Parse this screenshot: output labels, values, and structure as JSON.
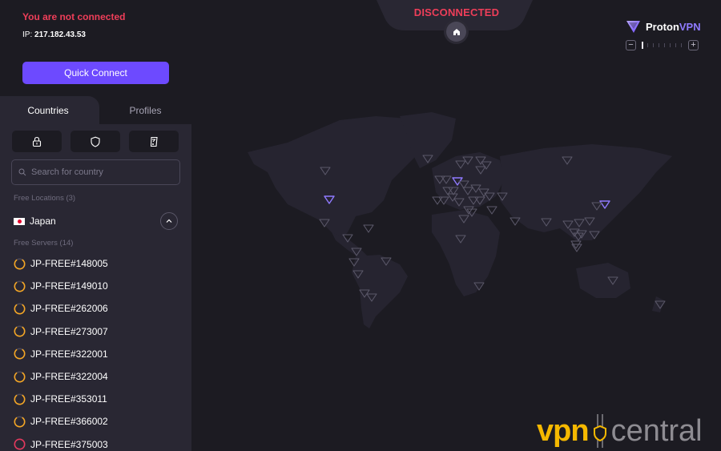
{
  "connection": {
    "status_text": "You are not connected",
    "ip_label": "IP:",
    "ip_value": "217.182.43.53",
    "quick_connect_label": "Quick Connect",
    "map_status": "DISCONNECTED"
  },
  "tabs": [
    {
      "label": "Countries",
      "active": true
    },
    {
      "label": "Profiles",
      "active": false
    }
  ],
  "filters": [
    {
      "icon": "lock-icon",
      "label": "Secure Core"
    },
    {
      "icon": "shield-icon",
      "label": "NetShield"
    },
    {
      "icon": "document-phone-icon",
      "label": "Streaming"
    }
  ],
  "search": {
    "placeholder": "Search for country",
    "value": ""
  },
  "free_locations": {
    "label": "Free Locations (3)",
    "country": {
      "name": "Japan",
      "flag": "jp-flag",
      "expanded": true
    }
  },
  "free_servers": {
    "label": "Free Servers (14)",
    "items": [
      {
        "name": "JP-FREE#148005",
        "load_color": "#f5a623"
      },
      {
        "name": "JP-FREE#149010",
        "load_color": "#f5a623"
      },
      {
        "name": "JP-FREE#262006",
        "load_color": "#f5a623"
      },
      {
        "name": "JP-FREE#273007",
        "load_color": "#f5a623"
      },
      {
        "name": "JP-FREE#322001",
        "load_color": "#f5a623"
      },
      {
        "name": "JP-FREE#322004",
        "load_color": "#f5a623"
      },
      {
        "name": "JP-FREE#353011",
        "load_color": "#f5a623"
      },
      {
        "name": "JP-FREE#366002",
        "load_color": "#f5a623"
      },
      {
        "name": "JP-FREE#375003",
        "load_color": "#e5375c"
      }
    ]
  },
  "brand": {
    "name_part1": "Proton",
    "name_part2": "VPN"
  },
  "map_zoom": {
    "minus_label": "−",
    "plus_label": "+",
    "level": 0
  },
  "watermark": {
    "part1": "vpn",
    "part2": "central"
  },
  "colors": {
    "accent": "#6d4aff",
    "danger": "#ee3e59",
    "load_medium": "#f5a623",
    "load_high": "#e5375c",
    "marker_free": "#8f7aff",
    "marker_default": "#5b5869"
  }
}
